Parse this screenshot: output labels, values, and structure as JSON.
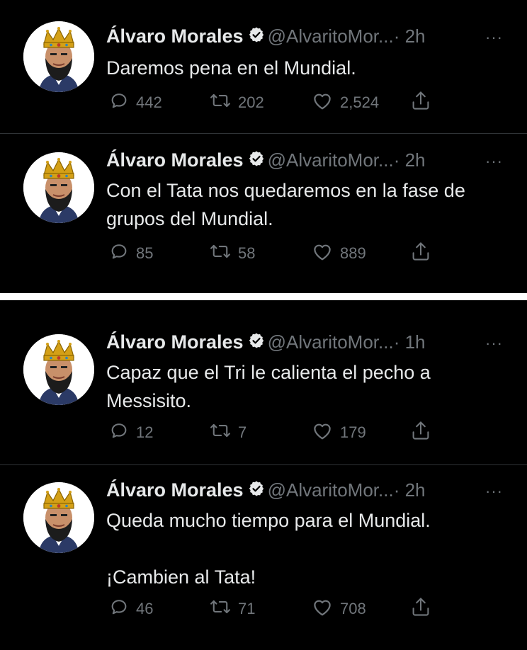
{
  "tweets": [
    {
      "name": "Álvaro Morales",
      "handle": "@AlvaritoMor...",
      "time": "· 2h",
      "more": "···",
      "text": "Daremos pena en el Mundial.",
      "replies": "442",
      "retweets": "202",
      "likes": "2,524"
    },
    {
      "name": "Álvaro Morales",
      "handle": "@AlvaritoMor...",
      "time": "· 2h",
      "more": "···",
      "text": "Con el Tata nos quedaremos en la fase de\ngrupos del Mundial.",
      "replies": "85",
      "retweets": "58",
      "likes": "889"
    },
    {
      "name": "Álvaro Morales",
      "handle": "@AlvaritoMor...",
      "time": "· 1h",
      "more": "···",
      "text": "Capaz que el Tri le calienta el pecho a\nMessisito.",
      "replies": "12",
      "retweets": "7",
      "likes": "179"
    },
    {
      "name": "Álvaro Morales",
      "handle": "@AlvaritoMor...",
      "time": "· 2h",
      "more": "···",
      "text": "Queda mucho tiempo para el Mundial.\n\n¡Cambien al Tata!",
      "replies": "46",
      "retweets": "71",
      "likes": "708"
    }
  ],
  "icons": {
    "verified": "verified-badge-icon",
    "reply": "reply-icon",
    "retweet": "retweet-icon",
    "like": "heart-icon",
    "share": "share-icon"
  },
  "colors": {
    "background": "#000000",
    "text_primary": "#e7e9ea",
    "text_secondary": "#71767b",
    "separator": "#2f3336",
    "crown": "#d4a017"
  }
}
